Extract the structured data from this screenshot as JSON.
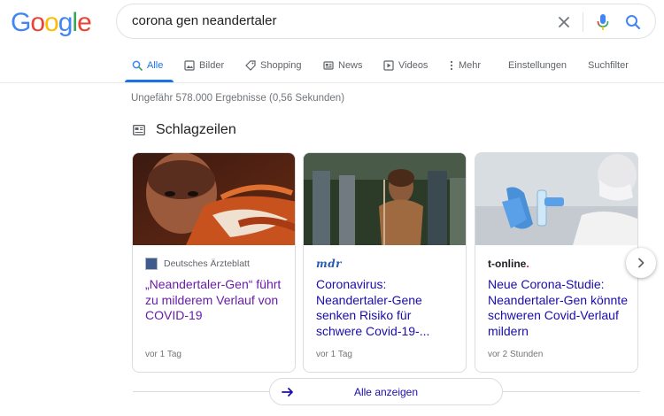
{
  "logo": {
    "letters": [
      "G",
      "o",
      "o",
      "g",
      "l",
      "e"
    ]
  },
  "search": {
    "query": "corona gen neandertaler"
  },
  "tabs": [
    {
      "label": "Alle",
      "icon": "search-icon"
    },
    {
      "label": "Bilder",
      "icon": "image-icon"
    },
    {
      "label": "Shopping",
      "icon": "tag-icon"
    },
    {
      "label": "News",
      "icon": "newspaper-icon"
    },
    {
      "label": "Videos",
      "icon": "play-icon"
    },
    {
      "label": "Mehr",
      "icon": "more-vert-icon"
    }
  ],
  "tools": {
    "settings": "Einstellungen",
    "filter": "Suchfilter"
  },
  "result_stats": "Ungefähr 578.000 Ergebnisse (0,56 Sekunden)",
  "headlines": {
    "title": "Schlagzeilen",
    "cards": [
      {
        "source": "Deutsches Ärzteblatt",
        "title": "„Neandertaler-Gen“ führt zu milderem Verlauf von COVID-19",
        "time": "vor 1 Tag"
      },
      {
        "source": "mdr",
        "title": "Coronavirus: Neandertaler-Gene senken Risiko für schwere Covid-19-...",
        "time": "vor 1 Tag"
      },
      {
        "source": "t-online",
        "source_dot": ".",
        "title": "Neue Corona-Studie: Neandertaler-Gen könnte schweren Covid-Verlauf mildern",
        "time": "vor 2 Stunden"
      }
    ],
    "show_all": "Alle anzeigen"
  },
  "colors": {
    "link": "#1a0dab",
    "visited": "#681da8",
    "accent": "#1a73e8",
    "muted": "#70757a"
  }
}
